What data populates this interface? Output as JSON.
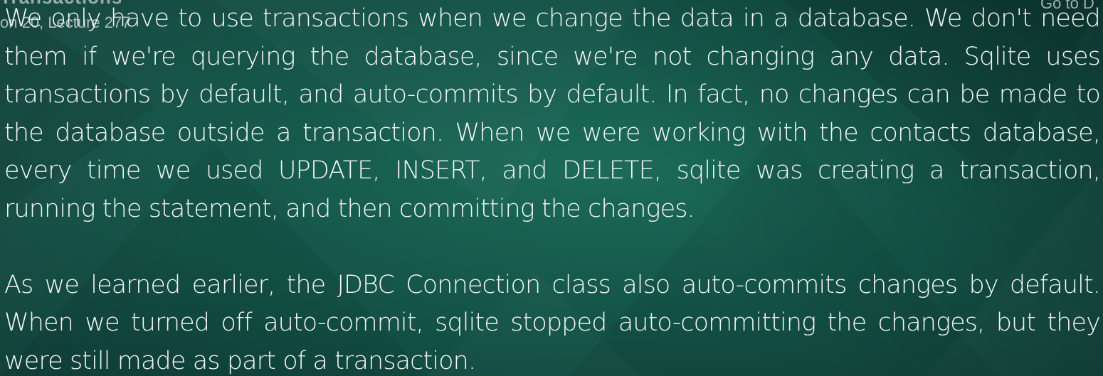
{
  "overlay": {
    "title": "Transactions",
    "lecture_label": "on 20, Lecture 277",
    "goto_label": "Go to D"
  },
  "slide": {
    "paragraphs": [
      "We only have to use transactions when we change the data in a database. We don't need them if we're querying the database, since we're not changing any data. Sqlite uses transactions by default, and auto-commits by default. In fact, no changes can be made to the database outside a transaction. When we were working with the contacts database, every time we used UPDATE, INSERT, and DELETE, sqlite was creating a transaction, running the statement, and then committing the changes.",
      "As we learned earlier, the JDBC Connection class also auto-commits changes by default. When we turned off auto-commit, sqlite stopped auto-committing the changes, but they were still made as part of a transaction."
    ]
  },
  "colors": {
    "background": "#15574a",
    "text": "#f2f5f4"
  }
}
